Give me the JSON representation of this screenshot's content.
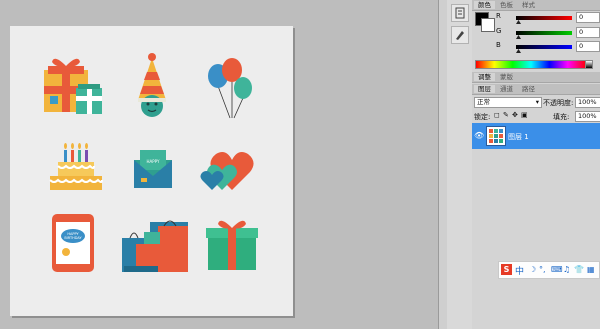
{
  "colors": {
    "accent": "#3b8fe8",
    "canvas": "#bdbdbd",
    "document": "#ededed",
    "brand_sogou": "#e63a25"
  },
  "color_panel": {
    "tabs": [
      "颜色",
      "色板",
      "样式"
    ],
    "channels": [
      {
        "label": "R",
        "value": "0"
      },
      {
        "label": "G",
        "value": "0"
      },
      {
        "label": "B",
        "value": "0"
      }
    ]
  },
  "adjust_panel": {
    "tabs": [
      "调整",
      "蒙版"
    ]
  },
  "layers_panel": {
    "tabs": [
      "图层",
      "通道",
      "路径"
    ],
    "blend_mode": "正常",
    "opacity_label": "不透明度:",
    "opacity_value": "100%",
    "lock_label": "锁定:",
    "fill_label": "填充:",
    "fill_value": "100%",
    "layer_name": "图层 1"
  },
  "document": {
    "icons": [
      "gift-box-icon",
      "party-hat-icon",
      "balloons-icon",
      "birthday-cake-icon",
      "greeting-card-icon",
      "hearts-icon",
      "tablet-birthday-icon",
      "shopping-bags-icon",
      "wrapped-gift-icon"
    ],
    "card_text_small": "HAPPY",
    "tablet_text_1": "HAPPY",
    "tablet_text_2": "BIRTHDAY"
  },
  "ime": {
    "logo": "S",
    "mode": "中"
  }
}
